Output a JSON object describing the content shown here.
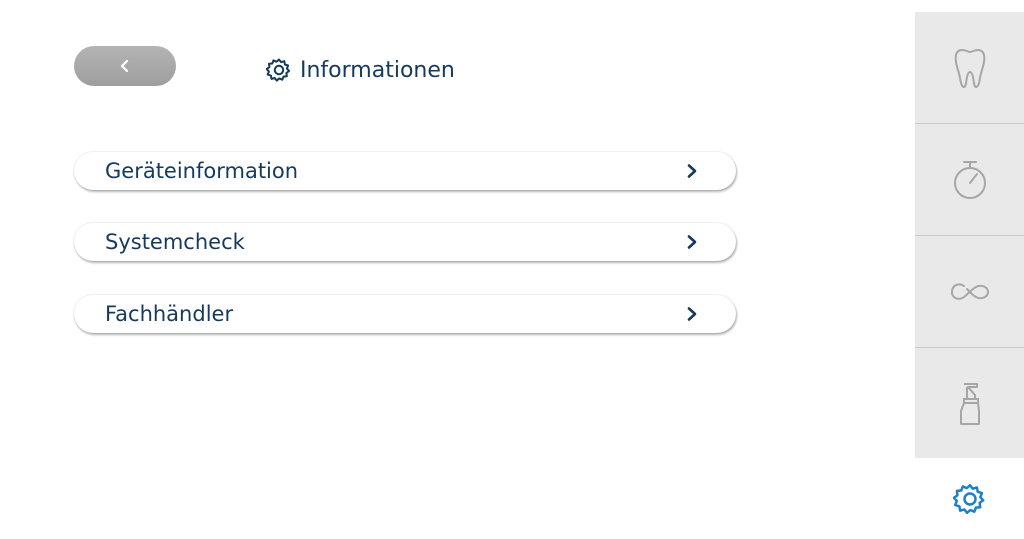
{
  "header": {
    "back_icon": "chevron-left-icon",
    "title_icon": "gear-icon",
    "title": "Informationen"
  },
  "menu": {
    "items": [
      {
        "label": "Geräteinformation",
        "icon": "chevron-right-icon"
      },
      {
        "label": "Systemcheck",
        "icon": "chevron-right-icon"
      },
      {
        "label": "Fachhändler",
        "icon": "chevron-right-icon"
      }
    ]
  },
  "sidebar": {
    "items": [
      {
        "icon": "tooth-icon"
      },
      {
        "icon": "stopwatch-icon"
      },
      {
        "icon": "infinity-icon"
      },
      {
        "icon": "spray-bottle-icon"
      },
      {
        "icon": "gear-icon",
        "active": true
      }
    ]
  },
  "colors": {
    "text": "#143a5c",
    "active_icon": "#1e7fc4",
    "inactive_icon": "#a6a6a6",
    "sidebar_bg": "#e9e9e9",
    "back_button": "#a8a8a8"
  }
}
